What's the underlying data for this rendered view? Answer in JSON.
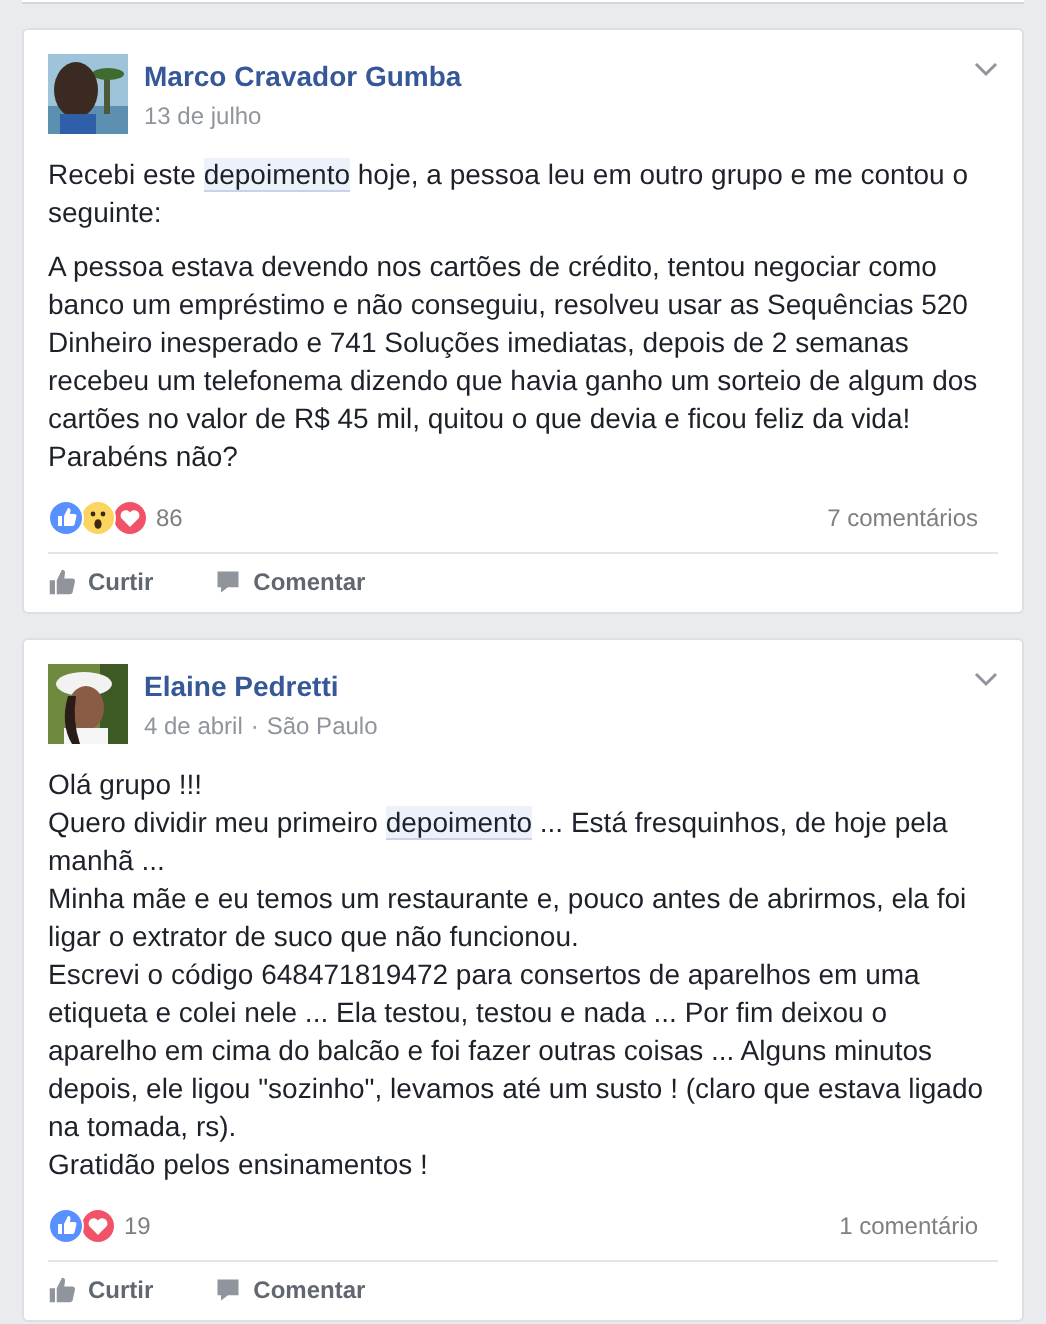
{
  "posts": [
    {
      "author": "Marco Cravador Gumba",
      "date": "13 de julho",
      "avatar": {
        "kind": "picture"
      },
      "paragraphs": [
        [
          [
            {
              "text": "Recebi este "
            },
            {
              "text": "depoimento",
              "highlighted": true
            },
            {
              "text": " hoje, a pessoa leu em outro grupo e me contou o seguinte:"
            }
          ]
        ],
        [
          [
            {
              "text": "A pessoa estava devendo nos cartões de crédito, tentou negociar como banco um empréstimo e não conseguiu, resolveu usar as Sequências 520 Dinheiro inesperado e 741 Soluções imediatas, depois de 2 semanas recebeu um telefonema dizendo que havia ganho um sorteio de algum dos cartões no valor de R$ 45 mil, quitou o que devia e ficou feliz da vida! Parabéns não?"
            }
          ]
        ]
      ],
      "reactions": [
        {
          "kind": "like"
        },
        {
          "kind": "wow"
        },
        {
          "kind": "love"
        }
      ],
      "reaction_count": "86",
      "comments": "7 comentários",
      "actions": [
        "Curtir",
        "Comentar"
      ]
    },
    {
      "author": "Elaine Pedretti",
      "date": "4 de abril",
      "separator": "·",
      "location": "São Paulo",
      "avatar": {
        "kind": "picture"
      },
      "paragraphs": [
        [
          [
            {
              "text": "Olá grupo !!!"
            }
          ],
          [
            {
              "text": "Quero dividir meu primeiro "
            },
            {
              "text": "depoimento",
              "highlighted": true
            },
            {
              "text": " ... Está fresquinhos, de hoje pela manhã ..."
            }
          ],
          [
            {
              "text": "Minha mãe e eu temos um restaurante e, pouco antes de abrirmos, ela foi ligar o extrator de suco que não funcionou."
            }
          ],
          [
            {
              "text": "Escrevi o código 648471819472 para consertos de aparelhos em uma etiqueta e colei nele ... Ela testou, testou e nada ... Por fim deixou o aparelho em cima do balcão e foi fazer outras coisas ... Alguns minutos depois, ele ligou \"sozinho\", levamos até um susto ! (claro que estava ligado na tomada, rs)."
            }
          ],
          [
            {
              "text": "Gratidão pelos ensinamentos !"
            }
          ]
        ]
      ],
      "reactions": [
        {
          "kind": "like"
        },
        {
          "kind": "love"
        }
      ],
      "reaction_count": "19",
      "comments": "1 comentário",
      "actions": [
        "Curtir",
        "Comentar"
      ]
    }
  ]
}
